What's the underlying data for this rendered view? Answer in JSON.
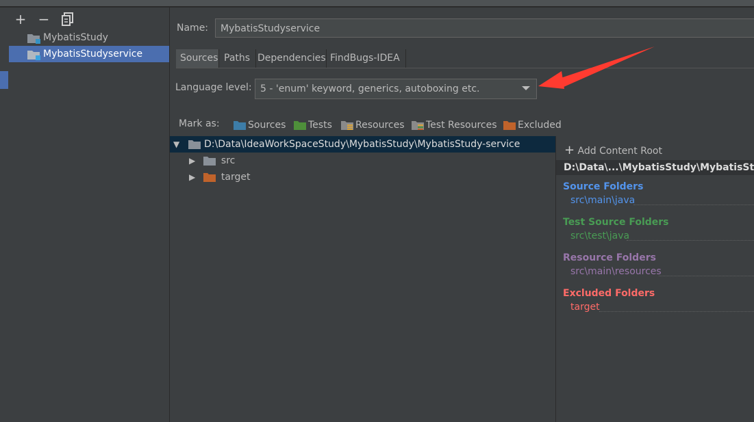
{
  "toolbar": {
    "add_icon": "plus-icon",
    "remove_icon": "minus-icon",
    "copy_icon": "copy-icon"
  },
  "sidebar": {
    "items": [
      {
        "label": "MybatisStudy",
        "selected": false
      },
      {
        "label": "MybatisStudyservice",
        "selected": true
      }
    ]
  },
  "name": {
    "label": "Name:",
    "value": "MybatisStudyservice"
  },
  "tabs": [
    {
      "label": "Sources",
      "active": true
    },
    {
      "label": "Paths",
      "active": false
    },
    {
      "label": "Dependencies",
      "active": false
    },
    {
      "label": "FindBugs-IDEA",
      "active": false
    }
  ],
  "language_level": {
    "label": "Language level:",
    "value": "5 - 'enum' keyword, generics, autoboxing etc."
  },
  "mark_as": {
    "label": "Mark as:",
    "buttons": [
      {
        "label": "Sources",
        "color": "#3d7da8"
      },
      {
        "label": "Tests",
        "color": "#4e8f3a"
      },
      {
        "label": "Resources",
        "color": "#8a8a8a"
      },
      {
        "label": "Test Resources",
        "color": "#8a8a8a"
      },
      {
        "label": "Excluded",
        "color": "#c0632b"
      }
    ]
  },
  "tree": {
    "root": "D:\\Data\\IdeaWorkSpaceStudy\\MybatisStudy\\MybatisStudy-service",
    "children": [
      {
        "label": "src",
        "color": "#8a9199"
      },
      {
        "label": "target",
        "color": "#c0632b"
      }
    ]
  },
  "content_root": {
    "add_label": "Add Content Root",
    "path": "D:\\Data\\...\\MybatisStudy\\MybatisStudy-service",
    "categories": [
      {
        "title": "Source Folders",
        "path": "src\\main\\java",
        "title_color": "#5394ec",
        "path_color": "#5394ec"
      },
      {
        "title": "Test Source Folders",
        "path": "src\\test\\java",
        "title_color": "#499c54",
        "path_color": "#499c54"
      },
      {
        "title": "Resource Folders",
        "path": "src\\main\\resources",
        "title_color": "#9876aa",
        "path_color": "#9876aa"
      },
      {
        "title": "Excluded Folders",
        "path": "target",
        "title_color": "#ff6b68",
        "path_color": "#ff6b68"
      }
    ]
  },
  "colors": {
    "accent": "#4b6eaf",
    "arrow": "#ff3b30"
  }
}
